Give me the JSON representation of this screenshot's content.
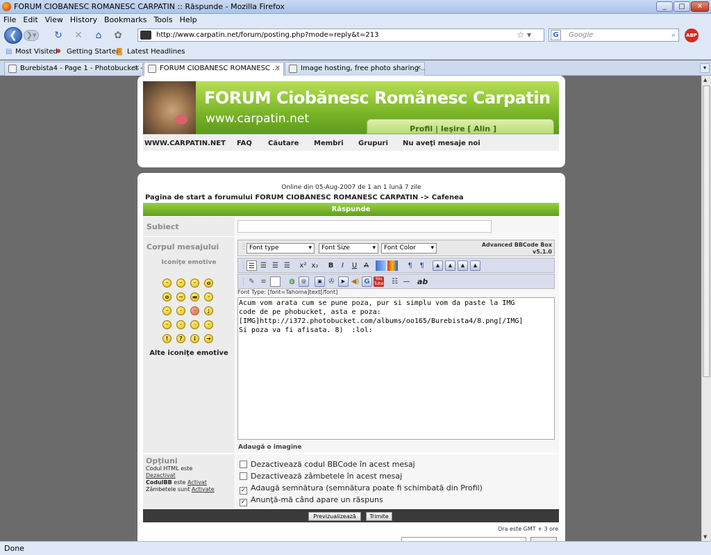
{
  "window": {
    "title": "FORUM CIOBANESC ROMANESC CARPATIN :: Răspunde - Mozilla Firefox",
    "controls": [
      "_",
      "□",
      "✕"
    ]
  },
  "menu": [
    "File",
    "Edit",
    "View",
    "History",
    "Bookmarks",
    "Tools",
    "Help"
  ],
  "nav": {
    "url": "http://www.carpatin.net/forum/posting.php?mode=reply&t=213",
    "search_placeholder": "Google",
    "abp": "ABP"
  },
  "bookmarks": [
    "Most Visited",
    "Getting Started",
    "Latest Headlines"
  ],
  "tabs": [
    "Burebista4 - Page 1 - Photobucket -...",
    "FORUM CIOBANESC ROMANESC ...",
    "Image hosting, free photo sharing ..."
  ],
  "status": "Done",
  "header": {
    "title": "FORUM Ciobănesc Românesc Carpatin",
    "site": "www.carpatin.net",
    "userbox": "Profil | Ieşire [ Alin ]",
    "nav": [
      "WWW.CARPATIN.NET",
      "FAQ",
      "Căutare",
      "Membri",
      "Grupuri",
      "Nu aveţi mesaje noi"
    ]
  },
  "post": {
    "online": "Online din 05-Aug-2007 de 1 an 1 lună 7 zile",
    "breadcrumb": "Pagina de start a forumului FORUM CIOBANESC ROMANESC CARPATIN -> Cafenea",
    "section_title": "Răspunde",
    "subject_label": "Subiect",
    "body_label": "Corpul mesajului",
    "emoticons_title": "Iconiţe emotive",
    "emoticons_more": "Alte iconiţe emotive",
    "font_type": "Font type",
    "font_size": "Font Size",
    "font_color": "Font Color",
    "bbcode_name": "Advanced BBCode Box",
    "bbcode_version": "v5.1.0",
    "font_type_hint": "Font Type: [font=Tahoma]text[/font]",
    "message": "Acum vom arata cum se pune poza, pur si simplu vom da paste la IMG\ncode de pe phobucket, asta e poza:\n[IMG]http://i372.photobucket.com/albums/oo165/Burebista4/8.png[/IMG]\nSi poza va fi afisata. 8)  :lol:",
    "add_image": "Adaugă o imagine",
    "options_title": "Opţiuni",
    "opt_html": "Codul HTML este",
    "opt_html_val": "Dezactivat",
    "opt_bb": "CodulBB",
    "opt_bb_mid": "este",
    "opt_bb_val": "Activat",
    "opt_smiles": "Zâmbetele sunt",
    "opt_smiles_val": "Activate",
    "checks": [
      {
        "label": "Dezactivează codul BBCode în acest mesaj",
        "checked": false
      },
      {
        "label": "Dezactivează zâmbetele în acest mesaj",
        "checked": false
      },
      {
        "label": "Adaugă semnătura (semnătura poate fi schimbată din Profil)",
        "checked": true
      },
      {
        "label": "Anunţă-mă când apare un răspuns",
        "checked": true
      }
    ],
    "preview_btn": "Previzualizează",
    "submit_btn": "Trimite",
    "time": "Ora este GMT + 3 ore"
  }
}
